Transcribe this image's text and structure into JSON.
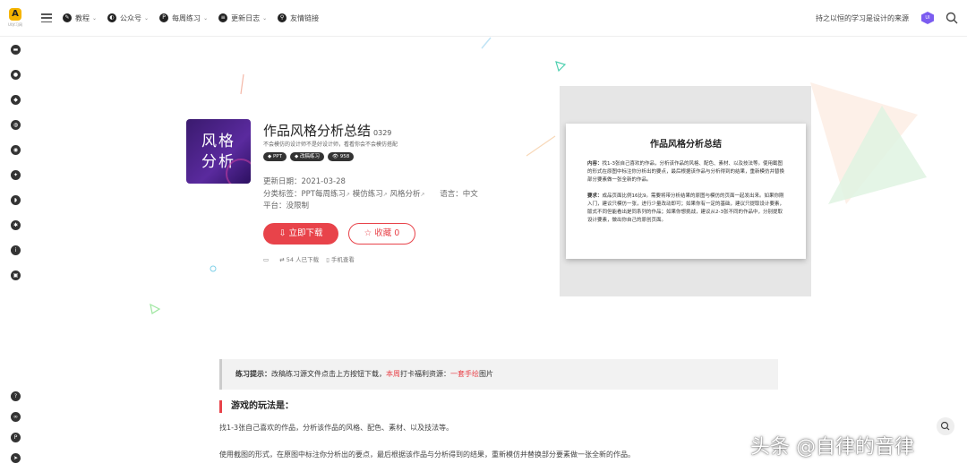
{
  "header": {
    "logo_label": "A",
    "logo_text": "UI学习网",
    "nav": [
      {
        "label": "教程",
        "icon": "pen-icon"
      },
      {
        "label": "公众号",
        "icon": "wechat-icon"
      },
      {
        "label": "每周练习",
        "icon": "p-badge-icon"
      },
      {
        "label": "更新日志",
        "icon": "log-icon"
      },
      {
        "label": "友情链接",
        "icon": "link-icon"
      }
    ],
    "nav_icon_glyphs": [
      "✎",
      "◐",
      "P",
      "≡",
      "⚲"
    ],
    "slogan": "持之以恒的学习是设计的来源",
    "avatar_text": "UI"
  },
  "product": {
    "cover_line1": "风格",
    "cover_line2": "分析",
    "title": "作品风格分析总结",
    "code": "0329",
    "subtitle": "不会模仿的设计师不是好设计师，看看你会不会模仿搭配",
    "tags": [
      "PPT",
      "改稿练习",
      "958"
    ],
    "update_label": "更新日期：",
    "update_date": "2021-03-28",
    "category_label": "分类标签：",
    "categories": [
      "PPT每周练习",
      "模仿练习",
      "风格分析"
    ],
    "language_label": "语言：",
    "language": "中文",
    "platform_label": "平台：",
    "platform": "没限制",
    "download_button": "立即下载",
    "favorite_label": "收藏",
    "favorite_count": "0",
    "download_count_text": "54 人已下载",
    "mobile_text": "手机查看"
  },
  "preview_card": {
    "title": "作品风格分析总结",
    "content_label": "内容：",
    "content_text": "找1-3张自己喜欢的作品，分析该作品的风格、配色、素材、以及技法等。使用截图的形式在原图中标注你分析出的要点，最后根据该作品与分析得到的结果，重新模仿并替换部分要素做一张全新的作品。",
    "requirement_label": "要求：",
    "requirement_text": "成品页面比例16比9。需要将带分析结果的原图与模仿的页面一起发出来。如果你刚入门，建议只模仿一张，进行少量改动即可；如果你有一定的基础，建议只提取设计要素，版式不同但能看出是同系列的作品；如果你想挑战，建议从2-3张不同的作品中，分别提取设计要素，做出你自己的原创页面。"
  },
  "tip": {
    "label": "练习提示：",
    "text1": "改稿练习源文件点击上方按钮下载，",
    "highlight1": "本周",
    "text2": "打卡福利资源：",
    "highlight2": "一套手绘",
    "text3": "图片"
  },
  "article": {
    "heading": "游戏的玩法是：",
    "para1": "找1-3张自己喜欢的作品，分析该作品的风格、配色、素材、以及技法等。",
    "para2": "使用截图的形式，在原图中标注你分析出的要点，最后根据该作品与分析得到的结果，重新模仿并替换部分要素做一张全新的作品。"
  },
  "watermark": "头条 @自律的音律",
  "colors": {
    "accent": "#e8434a",
    "dark": "#333333",
    "preview_bg": "#e6e6e6"
  }
}
